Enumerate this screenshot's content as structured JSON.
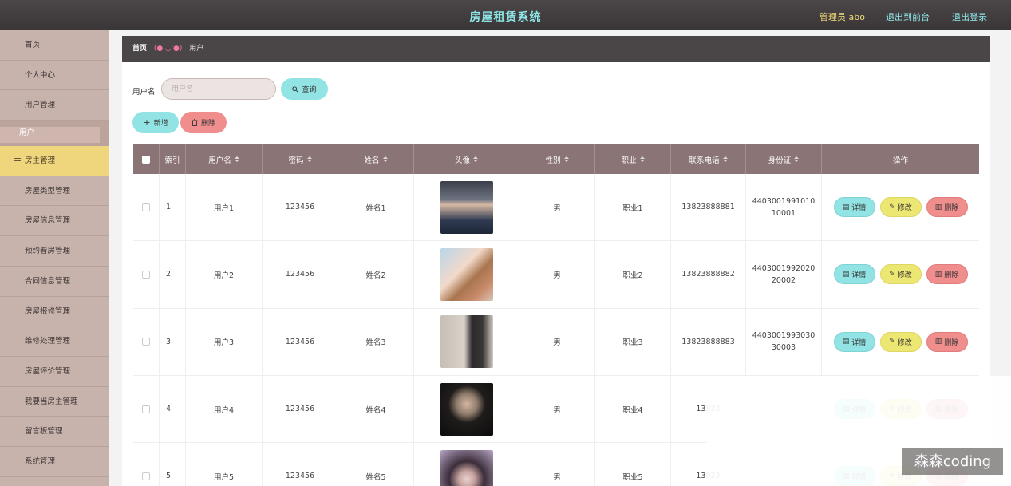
{
  "header": {
    "title": "房屋租赁系统",
    "admin": "管理员 abo",
    "front": "退出到前台",
    "logout": "退出登录"
  },
  "sidebar": {
    "items": [
      {
        "label": "首页",
        "type": "normal"
      },
      {
        "label": "个人中心",
        "type": "normal"
      },
      {
        "label": "用户管理",
        "type": "normal"
      },
      {
        "label": "用户",
        "type": "sub"
      },
      {
        "label": "房主管理",
        "type": "active"
      },
      {
        "label": "房屋类型管理",
        "type": "normal"
      },
      {
        "label": "房屋信息管理",
        "type": "normal"
      },
      {
        "label": "预约看房管理",
        "type": "normal"
      },
      {
        "label": "合同信息管理",
        "type": "normal"
      },
      {
        "label": "房屋报修管理",
        "type": "normal"
      },
      {
        "label": "维修处理管理",
        "type": "normal"
      },
      {
        "label": "房屋评价管理",
        "type": "normal"
      },
      {
        "label": "我要当房主管理",
        "type": "normal"
      },
      {
        "label": "留言板管理",
        "type": "normal"
      },
      {
        "label": "系统管理",
        "type": "normal"
      }
    ]
  },
  "breadcrumb": {
    "home": "首页",
    "sep": "(●'◡'●)",
    "current": "用户"
  },
  "search": {
    "label": "用户名",
    "placeholder": "用户名",
    "button": "查询"
  },
  "actions": {
    "add": "新增",
    "delete": "删除"
  },
  "table": {
    "headers": [
      "",
      "索引",
      "用户名",
      "密码",
      "姓名",
      "头像",
      "性别",
      "职业",
      "联系电话",
      "身份证",
      "操作"
    ],
    "sortable": [
      false,
      false,
      true,
      true,
      true,
      true,
      true,
      true,
      true,
      true,
      false
    ],
    "rows": [
      {
        "index": "1",
        "username": "用户1",
        "password": "123456",
        "name": "姓名1",
        "gender": "男",
        "job": "职业1",
        "phone": "13823888881",
        "idcard": "440300199101010001"
      },
      {
        "index": "2",
        "username": "用户2",
        "password": "123456",
        "name": "姓名2",
        "gender": "男",
        "job": "职业2",
        "phone": "13823888882",
        "idcard": "440300199202020002"
      },
      {
        "index": "3",
        "username": "用户3",
        "password": "123456",
        "name": "姓名3",
        "gender": "男",
        "job": "职业3",
        "phone": "13823888883",
        "idcard": "440300199303030003"
      },
      {
        "index": "4",
        "username": "用户4",
        "password": "123456",
        "name": "姓名4",
        "gender": "男",
        "job": "职业4",
        "phone": "13823",
        "idcard": ""
      },
      {
        "index": "5",
        "username": "用户5",
        "password": "123456",
        "name": "姓名5",
        "gender": "男",
        "job": "职业5",
        "phone": "13823",
        "idcard": ""
      }
    ],
    "row_actions": {
      "detail": "详情",
      "edit": "修改",
      "delete": "删除"
    }
  },
  "watermark": "森森coding",
  "colors": {
    "header_bg": "#3f3a3c",
    "title": "#8fe6e6",
    "sidebar_bg": "#c8b3ac",
    "active": "#efd57c",
    "table_head": "#8a7475",
    "cyan": "#92e3e3",
    "yellow": "#ece672",
    "red": "#f08e8e"
  }
}
